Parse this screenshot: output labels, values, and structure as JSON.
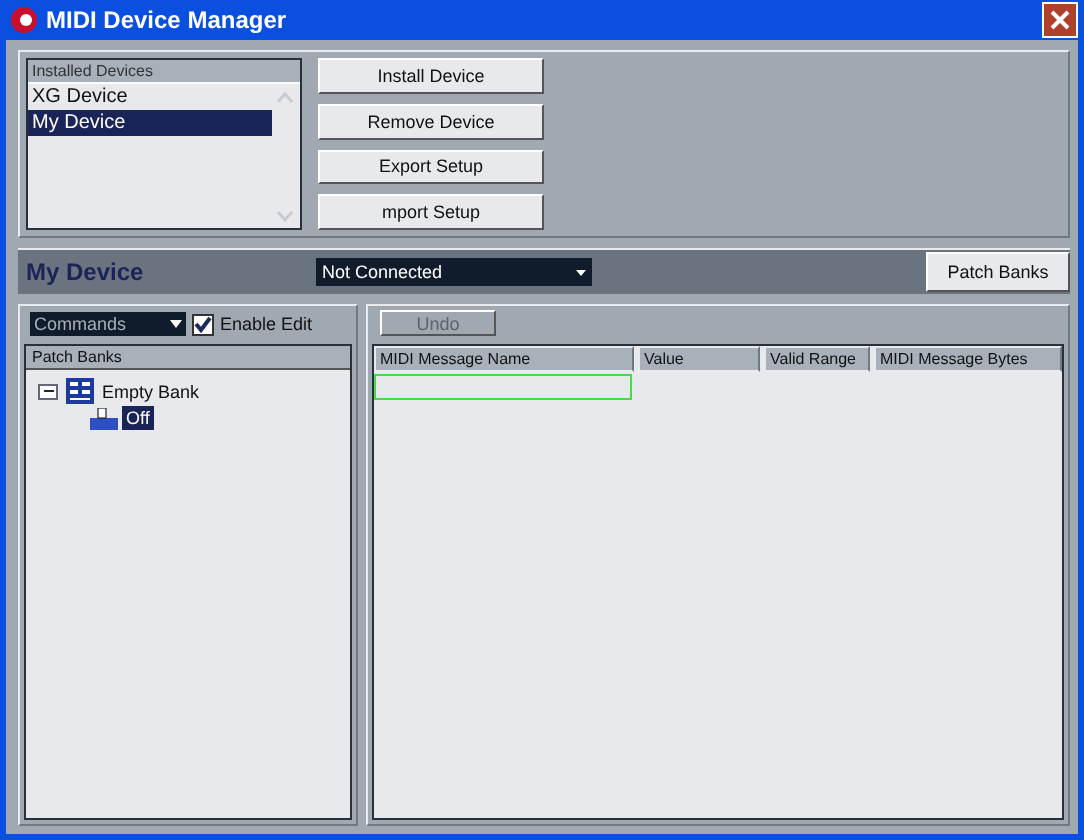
{
  "window": {
    "title": "MIDI Device Manager"
  },
  "installed_devices": {
    "header": "Installed Devices",
    "items": [
      {
        "label": "XG Device",
        "selected": false
      },
      {
        "label": "My Device",
        "selected": true
      }
    ]
  },
  "actions": [
    "Install Device",
    "Remove Device",
    "Export Setup",
    "mport Setup"
  ],
  "device": {
    "name": "My Device",
    "port": "Not Connected",
    "patch_banks_button": "Patch Banks"
  },
  "editor": {
    "commands": "Commands",
    "enable_edit": {
      "label": "Enable Edit",
      "checked": true
    },
    "tree_header": "Patch Banks",
    "tree": [
      {
        "label": "Empty Bank",
        "expanded": true,
        "children": [
          {
            "label": "Off",
            "selected": true
          }
        ]
      }
    ]
  },
  "details": {
    "undo": {
      "label": "Undo",
      "disabled": true
    },
    "columns": [
      "MIDI Message Name",
      "Value",
      "Valid Range",
      "MIDI Message Bytes"
    ]
  }
}
